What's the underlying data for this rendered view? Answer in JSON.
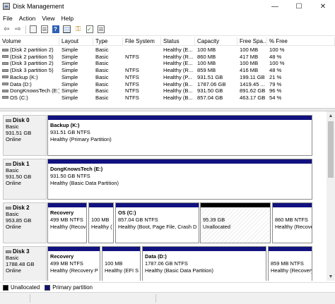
{
  "window": {
    "title": "Disk Management",
    "controls": [
      "—",
      "☐",
      "✕"
    ]
  },
  "menu": [
    "File",
    "Action",
    "View",
    "Help"
  ],
  "volumes": {
    "columns": [
      "Volume",
      "Layout",
      "Type",
      "File System",
      "Status",
      "Capacity",
      "Free Spa...",
      "% Free"
    ],
    "rows": [
      [
        "(Disk 2 partition 2)",
        "Simple",
        "Basic",
        "",
        "Healthy (E...",
        "100 MB",
        "100 MB",
        "100 %"
      ],
      [
        "(Disk 2 partition 5)",
        "Simple",
        "Basic",
        "NTFS",
        "Healthy (R...",
        "860 MB",
        "417 MB",
        "48 %"
      ],
      [
        "(Disk 3 partition 2)",
        "Simple",
        "Basic",
        "",
        "Healthy (E...",
        "100 MB",
        "100 MB",
        "100 %"
      ],
      [
        "(Disk 3 partition 5)",
        "Simple",
        "Basic",
        "NTFS",
        "Healthy (R...",
        "859 MB",
        "416 MB",
        "48 %"
      ],
      [
        "Backup (K:)",
        "Simple",
        "Basic",
        "NTFS",
        "Healthy (P...",
        "931.51 GB",
        "199.11 GB",
        "21 %"
      ],
      [
        "Data (D:)",
        "Simple",
        "Basic",
        "NTFS",
        "Healthy (B...",
        "1787.06 GB",
        "1419.45 ...",
        "79 %"
      ],
      [
        "DongKnowsTech (E:)",
        "Simple",
        "Basic",
        "NTFS",
        "Healthy (B...",
        "931.50 GB",
        "891.62 GB",
        "96 %"
      ],
      [
        "OS (C:)",
        "Simple",
        "Basic",
        "NTFS",
        "Healthy (B...",
        "857.04 GB",
        "463.17 GB",
        "54 %"
      ]
    ]
  },
  "disks": [
    {
      "name": "Disk 0",
      "kind": "Basic",
      "size": "931.51 GB",
      "state": "Online",
      "partitions": [
        {
          "name": "Backup  (K:)",
          "size": "931.51 GB NTFS",
          "status": "Healthy (Primary Partition)",
          "kind": "primary"
        }
      ]
    },
    {
      "name": "Disk 1",
      "kind": "Basic",
      "size": "931.50 GB",
      "state": "Online",
      "partitions": [
        {
          "name": "DongKnowsTech  (E:)",
          "size": "931.50 GB NTFS",
          "status": "Healthy (Basic Data Partition)",
          "kind": "primary"
        }
      ]
    },
    {
      "name": "Disk 2",
      "kind": "Basic",
      "size": "953.85 GB",
      "state": "Online",
      "partitions": [
        {
          "name": "Recovery",
          "size": "499 MB NTFS",
          "status": "Healthy (Recov",
          "kind": "primary"
        },
        {
          "name": "",
          "size": "100 MB",
          "status": "Healthy (",
          "kind": "primary"
        },
        {
          "name": "OS  (C:)",
          "size": "857.04 GB NTFS",
          "status": "Healthy (Boot, Page File, Crash D",
          "kind": "primary"
        },
        {
          "name": "",
          "size": "95.39 GB",
          "status": "Unallocated",
          "kind": "unallocated"
        },
        {
          "name": "",
          "size": "860 MB NTFS",
          "status": "Healthy (Recove",
          "kind": "primary"
        }
      ]
    },
    {
      "name": "Disk 3",
      "kind": "Basic",
      "size": "1788.48 GB",
      "state": "Online",
      "partitions": [
        {
          "name": "Recovery",
          "size": "499 MB NTFS",
          "status": "Healthy (Recovery P",
          "kind": "primary"
        },
        {
          "name": "",
          "size": "100 MB",
          "status": "Healthy (EFI S",
          "kind": "primary"
        },
        {
          "name": "Data  (D:)",
          "size": "1787.06 GB NTFS",
          "status": "Healthy (Basic Data Partition)",
          "kind": "primary"
        },
        {
          "name": "",
          "size": "859 MB NTFS",
          "status": "Healthy (Recovery Par",
          "kind": "primary"
        }
      ]
    }
  ],
  "legend": [
    {
      "label": "Unallocated",
      "color": "#000000"
    },
    {
      "label": "Primary partition",
      "color": "#11117f"
    }
  ]
}
